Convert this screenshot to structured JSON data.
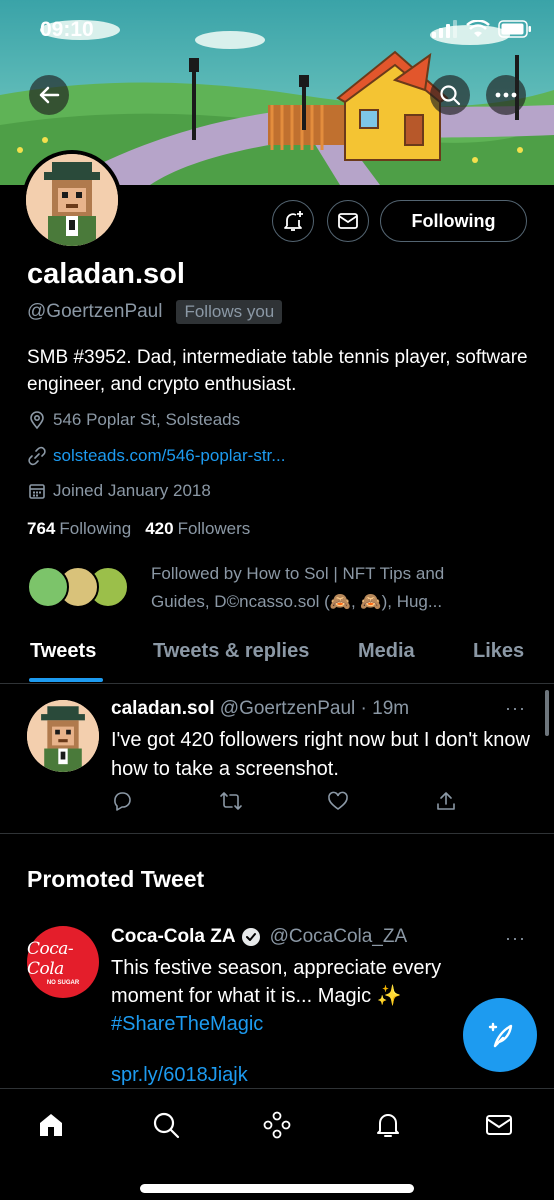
{
  "status_bar": {
    "time": "09:10"
  },
  "profile": {
    "name": "caladan.sol",
    "handle": "@GoertzenPaul",
    "follows_you": "Follows you",
    "following_button": "Following",
    "bio": "SMB #3952. Dad, intermediate table tennis player, software engineer, and crypto enthusiast.",
    "location": "546 Poplar St, Solsteads",
    "link": "solsteads.com/546-poplar-str...",
    "joined": "Joined January 2018",
    "following_count": "764",
    "following_label": "Following",
    "followers_count": "420",
    "followers_label": "Followers",
    "followed_by": "Followed by How to Sol | NFT Tips and Guides, D©ncasso.sol (🙈, 🙈), Hug..."
  },
  "tabs": [
    {
      "label": "Tweets",
      "active": true
    },
    {
      "label": "Tweets & replies",
      "active": false
    },
    {
      "label": "Media",
      "active": false
    },
    {
      "label": "Likes",
      "active": false
    }
  ],
  "tweet": {
    "name": "caladan.sol",
    "handle": "@GoertzenPaul",
    "time": "· 19m",
    "text": "I've got 420 followers right now but I don't know how to take a screenshot.",
    "more": "···"
  },
  "promoted": {
    "section_title": "Promoted Tweet",
    "name": "Coca-Cola ZA",
    "handle": "@CocaCola_ZA",
    "text": "This festive season, appreciate every moment for what it is... Magic ✨",
    "hashtag": "#ShareTheMagic",
    "link": "spr.ly/6018Jiajk",
    "avatar_script": "Coca-Cola",
    "avatar_sub": "NO SUGAR",
    "more": "···"
  },
  "colors": {
    "accent": "#1d9bf0",
    "background": "#000000",
    "muted_text": "#8b98a5",
    "coke_red": "#e41e2b"
  },
  "icons": {
    "nav": [
      "home-icon",
      "search-icon",
      "spaces-icon",
      "notifications-icon",
      "messages-icon"
    ],
    "tweet_actions": [
      "reply-icon",
      "retweet-icon",
      "like-icon",
      "share-icon"
    ]
  }
}
